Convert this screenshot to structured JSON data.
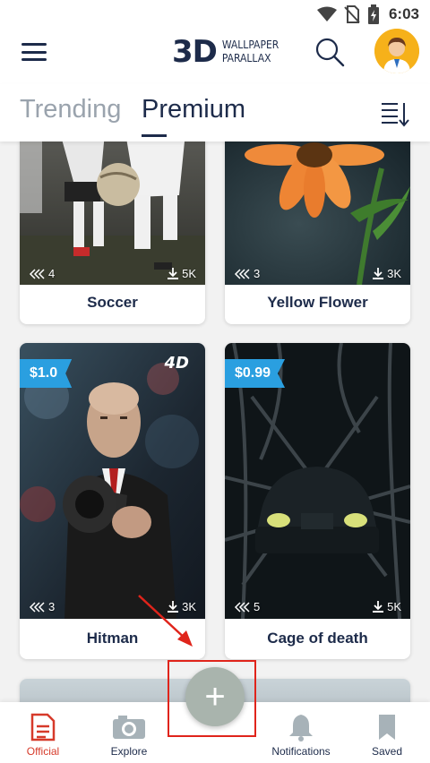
{
  "status_bar": {
    "time": "6:03"
  },
  "app": {
    "logo_main": "3D",
    "logo_line1": "WALLPAPER",
    "logo_line2": "PARALLAX"
  },
  "tabs": [
    {
      "label": "Trending",
      "active": false
    },
    {
      "label": "Premium",
      "active": true
    }
  ],
  "cards": [
    {
      "title": "Soccer",
      "layers": "4",
      "downloads": "5K"
    },
    {
      "title": "Yellow Flower",
      "layers": "3",
      "downloads": "3K"
    },
    {
      "title": "Hitman",
      "layers": "3",
      "downloads": "3K",
      "price": "$1.0",
      "badge": "4D"
    },
    {
      "title": "Cage of death",
      "layers": "5",
      "downloads": "5K",
      "price": "$0.99"
    }
  ],
  "bottom_nav": [
    {
      "label": "Official",
      "active": true
    },
    {
      "label": "Explore",
      "active": false
    },
    {
      "label": "Notifications",
      "active": false
    },
    {
      "label": "Saved",
      "active": false
    }
  ],
  "fab": {
    "icon": "plus-icon",
    "symbol": "+"
  },
  "colors": {
    "navy": "#1d2b4a",
    "accent_red": "#d63a2a",
    "price_blue": "#2a9fe0",
    "fab_gray": "#a9b4ad",
    "highlight": "#e0241b"
  }
}
